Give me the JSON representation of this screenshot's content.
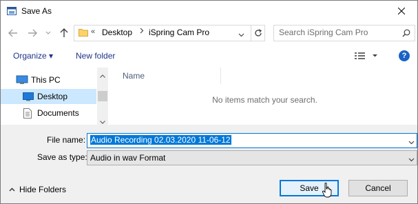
{
  "window": {
    "title": "Save As"
  },
  "address": {
    "overflow": "«",
    "segments": [
      "Desktop",
      "iSpring Cam Pro"
    ]
  },
  "search": {
    "placeholder": "Search iSpring Cam Pro"
  },
  "toolbar": {
    "organize": "Organize ▾",
    "new_folder": "New folder"
  },
  "nav": {
    "items": [
      {
        "label": "This PC",
        "icon": "pc-icon"
      },
      {
        "label": "Desktop",
        "icon": "desktop-icon",
        "selected": true
      },
      {
        "label": "Documents",
        "icon": "documents-icon"
      }
    ]
  },
  "content": {
    "column_name": "Name",
    "empty_message": "No items match your search."
  },
  "form": {
    "file_name_label": "File name:",
    "file_name_value": "Audio Recording 02.03.2020 11-06-12",
    "save_type_label": "Save as type:",
    "save_type_value": "Audio in wav Format"
  },
  "footer": {
    "hide_folders": "Hide Folders",
    "save": "Save",
    "cancel": "Cancel"
  },
  "colors": {
    "accent": "#0078d7",
    "selected_bg": "#cce8ff",
    "link": "#1e3287"
  }
}
